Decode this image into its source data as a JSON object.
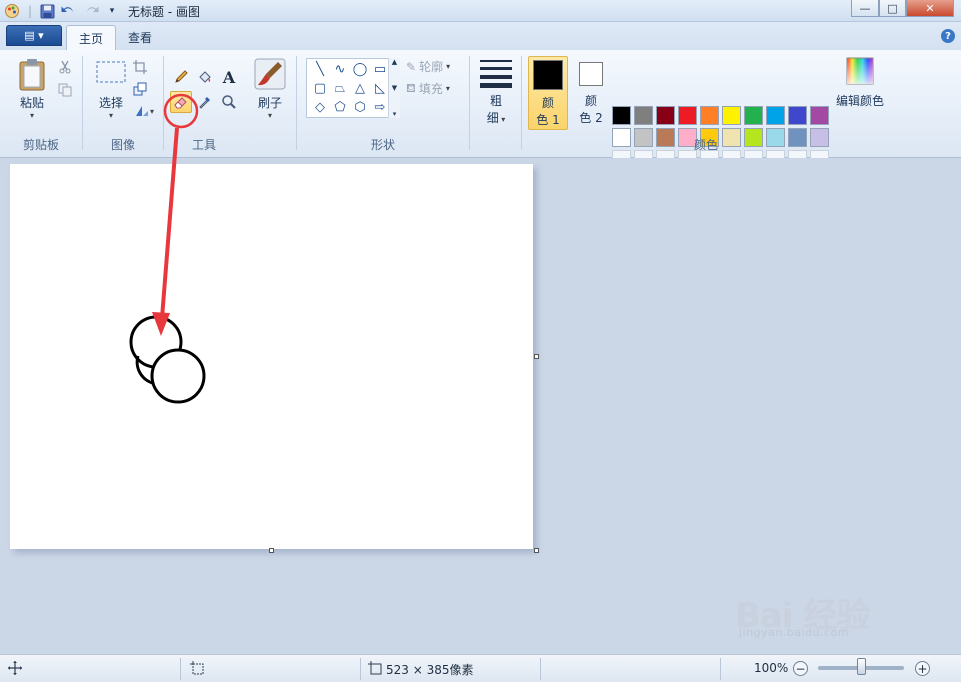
{
  "window": {
    "title": "无标题 - 画图",
    "minimize_glyph": "—",
    "maximize_glyph": "□",
    "close_glyph": "✕"
  },
  "tabs": [
    {
      "label": "主页",
      "active": true
    },
    {
      "label": "查看",
      "active": false
    }
  ],
  "help_glyph": "?",
  "app_menu_glyph": "▤ ▾",
  "ribbon": {
    "clipboard": {
      "paste_label": "粘贴",
      "group_label": "剪贴板"
    },
    "image": {
      "select_label": "选择",
      "group_label": "图像"
    },
    "tools": {
      "group_label": "工具",
      "text_tool_glyph": "A"
    },
    "brushes": {
      "label": "刷子"
    },
    "shapes": {
      "outline_label": "轮廓",
      "fill_label": "填充",
      "group_label": "形状"
    },
    "size": {
      "label_line1": "粗",
      "label_line2": "细"
    },
    "colors": {
      "color1_label_line1": "颜",
      "color1_label_line2": "色 1",
      "color2_label_line1": "颜",
      "color2_label_line2": "色 2",
      "edit_colors_label": "编辑颜色",
      "group_label": "颜色",
      "color1_value": "#000000",
      "color2_value": "#ffffff",
      "palette": [
        "#000000",
        "#7f7f7f",
        "#880015",
        "#ed1c24",
        "#ff7f27",
        "#fff200",
        "#22b14c",
        "#00a2e8",
        "#3f48cc",
        "#a349a4",
        "#ffffff",
        "#c3c3c3",
        "#b97a57",
        "#ffaec9",
        "#ffc90e",
        "#efe4b0",
        "#b5e61d",
        "#99d9ea",
        "#7092be",
        "#c8bfe7",
        "",
        "",
        "",
        "",
        "",
        "",
        "",
        "",
        "",
        ""
      ]
    }
  },
  "annotation": {
    "highlight_color": "#e8383d",
    "highlighted_tool": "eraser-tool"
  },
  "status": {
    "canvas_size": "523 × 385像素",
    "zoom": "100%",
    "zoom_level": 0.5,
    "zoom_out_glyph": "−",
    "zoom_in_glyph": "+"
  },
  "watermark": {
    "main": "Bai 经验",
    "sub": "jingyan.baidu.com"
  }
}
